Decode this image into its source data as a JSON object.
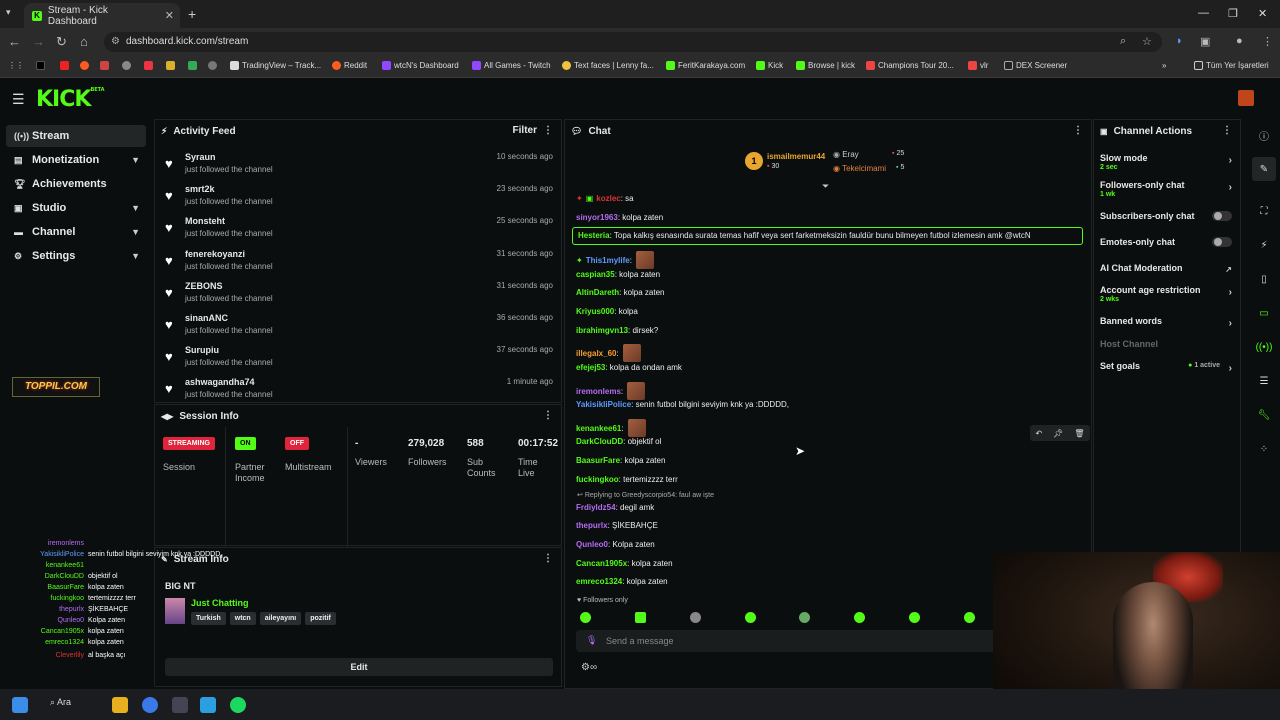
{
  "browser": {
    "tab_title": "Stream - Kick Dashboard",
    "url": "dashboard.kick.com/stream",
    "bookmarks": [
      "TradingView – Track...",
      "Reddit",
      "wtcN's Dashboard",
      "All Games - Twitch",
      "Text faces | Lenny fa...",
      "FeritKarakaya.com",
      "Kick",
      "Browse | kick",
      "Champions Tour 20...",
      "vlr",
      "DEX Screener"
    ],
    "bookmarks_folder": "Tüm Yer İşaretleri"
  },
  "header": {
    "logo": "KICK",
    "logo_beta": "BETA"
  },
  "sidebar": {
    "items": [
      {
        "label": "Stream"
      },
      {
        "label": "Monetization"
      },
      {
        "label": "Achievements"
      },
      {
        "label": "Studio"
      },
      {
        "label": "Channel"
      },
      {
        "label": "Settings"
      }
    ]
  },
  "activity_feed": {
    "title": "Activity Feed",
    "filter": "Filter",
    "items": [
      {
        "name": "Syraun",
        "action": "just followed the channel",
        "time": "10 seconds ago"
      },
      {
        "name": "smrt2k",
        "action": "just followed the channel",
        "time": "23 seconds ago"
      },
      {
        "name": "Monsteht",
        "action": "just followed the channel",
        "time": "25 seconds ago"
      },
      {
        "name": "fenerekoyanzi",
        "action": "just followed the channel",
        "time": "31 seconds ago"
      },
      {
        "name": "ZEBONS",
        "action": "just followed the channel",
        "time": "31 seconds ago"
      },
      {
        "name": "sinanANC",
        "action": "just followed the channel",
        "time": "36 seconds ago"
      },
      {
        "name": "Surupiu",
        "action": "just followed the channel",
        "time": "37 seconds ago"
      },
      {
        "name": "ashwagandha74",
        "action": "just followed the channel",
        "time": "1 minute ago"
      }
    ]
  },
  "session_info": {
    "title": "Session Info",
    "session_tag": "STREAMING",
    "session_label": "Session",
    "partner_tag": "ON",
    "partner_label": "Partner Income",
    "multi_tag": "OFF",
    "multi_label": "Multistream",
    "viewers_val": "-",
    "viewers_label": "Viewers",
    "followers_val": "279,028",
    "followers_label": "Followers",
    "subs_val": "588",
    "subs_label": "Sub Counts",
    "time_val": "00:17:52",
    "time_label": "Time Live"
  },
  "stream_info": {
    "title": "Stream Info",
    "stream_title": "BIG NT",
    "category": "Just Chatting",
    "tags": [
      "Turkish",
      "wtcn",
      "aileyayını",
      "pozitif"
    ],
    "edit": "Edit"
  },
  "chat": {
    "title": "Chat",
    "top_gifter": {
      "name": "ismailmemur44",
      "count": "30"
    },
    "gifter2": {
      "name": "Eray",
      "count": "25"
    },
    "gifter3": {
      "name": "Tekelcimami",
      "count": "5"
    },
    "messages": [
      {
        "user": "kozlec",
        "text": ": sa",
        "color": "#d33"
      },
      {
        "user": "sinyor1963",
        "text": ": kolpa zaten",
        "color": "#b46cf0"
      },
      {
        "user": "This1mylife",
        "text": ":",
        "color": "#5c9cff"
      },
      {
        "user": "caspian35",
        "text": ": kolpa zaten",
        "color": "#53fc18"
      },
      {
        "user": "AltinDareth",
        "text": ": kolpa zaten",
        "color": "#53fc18"
      },
      {
        "user": "Kriyus000",
        "text": ": kolpa",
        "color": "#53fc18"
      },
      {
        "user": "ibrahimgvn13",
        "text": ": dirsek?",
        "color": "#53fc18"
      },
      {
        "user": "illegalx_60",
        "text": ":",
        "color": "#f0a030"
      },
      {
        "user": "efejej53",
        "text": ": kolpa da ondan amk",
        "color": "#53fc18"
      },
      {
        "user": "iremonlems",
        "text": ":",
        "color": "#b46cf0"
      },
      {
        "user": "YakisikliPolice",
        "text": ": senin futbol bilgini seviyim knk ya :DDDDD,",
        "color": "#5c9cff"
      },
      {
        "user": "kenankee61",
        "text": ":",
        "color": "#53fc18"
      },
      {
        "user": "DarkClouDD",
        "text": ": objektif ol",
        "color": "#53fc18"
      },
      {
        "user": "BaasurFare",
        "text": ": kolpa zaten",
        "color": "#53fc18"
      },
      {
        "user": "fuckingkoo",
        "text": ": tertemizzzz terr",
        "color": "#53fc18"
      },
      {
        "user": "Frdiyldz54",
        "text": ": degil amk",
        "color": "#b46cf0"
      },
      {
        "user": "thepurlx",
        "text": ": ŞİKEBAHÇE",
        "color": "#b46cf0"
      },
      {
        "user": "Qunleo0",
        "text": ": Kolpa zaten",
        "color": "#b46cf0"
      },
      {
        "user": "Cancan1905x",
        "text": ": kolpa zaten",
        "color": "#53fc18"
      },
      {
        "user": "emreco1324",
        "text": ": kolpa zaten",
        "color": "#53fc18"
      }
    ],
    "highlight": {
      "user": "Hesteria",
      "text": ": Topa kalkış esnasında surata temas hafif veya sert farketmeksizin fauldür bunu bilmeyen futbol izlemesin amk @wtcN"
    },
    "reply_to": "Replying to Greedyscorpio54: faul aw işte",
    "followers_only": "Followers only",
    "placeholder": "Send a message"
  },
  "channel_actions": {
    "title": "Channel Actions",
    "slow_mode": "Slow mode",
    "slow_mode_sub": "2 sec",
    "followers_only": "Followers-only chat",
    "followers_only_sub": "1 wk",
    "subs_only": "Subscribers-only chat",
    "emotes_only": "Emotes-only chat",
    "ai_mod": "AI Chat Moderation",
    "age_restriction": "Account age restriction",
    "age_sub": "2 wks",
    "banned": "Banned words",
    "host": "Host Channel",
    "goals": "Set goals",
    "goals_active": "1 active"
  },
  "overlay": {
    "badge": "TOPPIL.COM",
    "lines": [
      {
        "u": "iremonlems",
        "t": "",
        "c": "#b46cf0"
      },
      {
        "u": "YakisikliPolice",
        "t": "senin futbol bilgini seviyim knk ya :DDDDD,",
        "c": "#5c9cff"
      },
      {
        "u": "kenankee61",
        "t": "",
        "c": "#53fc18"
      },
      {
        "u": "DarkClouDD",
        "t": "objektif ol",
        "c": "#53fc18"
      },
      {
        "u": "BaasurFare",
        "t": "kolpa zaten",
        "c": "#53fc18"
      },
      {
        "u": "fuckingkoo",
        "t": "tertemizzzz terr",
        "c": "#53fc18"
      },
      {
        "u": "thepurlx",
        "t": "ŞİKEBAHÇE",
        "c": "#b46cf0"
      },
      {
        "u": "Qunleo0",
        "t": "Kolpa zaten",
        "c": "#b46cf0"
      },
      {
        "u": "Cancan1905x",
        "t": "kolpa zaten",
        "c": "#53fc18"
      },
      {
        "u": "emreco1324",
        "t": "kolpa zaten",
        "c": "#53fc18"
      },
      {
        "u": "Cleverlily",
        "t": "al başka açı",
        "c": "#d33"
      }
    ]
  },
  "taskbar": {
    "search": "Ara"
  }
}
